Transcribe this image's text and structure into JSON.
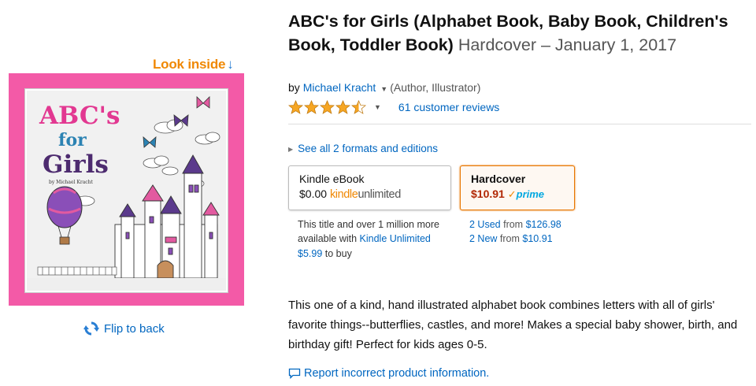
{
  "cover": {
    "look_inside": "Look inside",
    "title_line1": "ABC's",
    "title_line2": "for",
    "title_line3": "Girls",
    "author_small": "by Michael Kracht",
    "flip_label": "Flip to back"
  },
  "product": {
    "title": "ABC's for Girls (Alphabet Book, Baby Book, Children's Book, Toddler Book)",
    "format_date": "Hardcover – January 1, 2017",
    "by_prefix": "by",
    "author": "Michael Kracht",
    "author_role": "(Author, Illustrator)",
    "rating": 4.5,
    "reviews": "61 customer reviews",
    "see_all": "See all 2 formats and editions"
  },
  "formats": {
    "kindle": {
      "name": "Kindle eBook",
      "price": "$0.00",
      "ku_kindle": "kindle",
      "ku_unlimited": "unlimited"
    },
    "hardcover": {
      "name": "Hardcover",
      "price": "$10.91",
      "prime": "prime"
    }
  },
  "kindle_note": {
    "text1": "This title and over 1 million more available with",
    "link": "Kindle Unlimited",
    "price": "$5.99",
    "text2": "to buy"
  },
  "offers": {
    "used_link": "2 Used",
    "used_from": "from",
    "used_price": "$126.98",
    "new_link": "2 New",
    "new_from": "from",
    "new_price": "$10.91"
  },
  "description": "This one of a kind, hand illustrated alphabet book combines letters with all of girls' favorite things--butterflies, castles, and more! Makes a special baby shower, birth, and birthday gift! Perfect for kids ages 0-5.",
  "report": "Report incorrect product information.",
  "colors": {
    "link": "#0066c0",
    "price": "#b12704",
    "accent": "#f08804",
    "cover_pink": "#f35aa7"
  }
}
